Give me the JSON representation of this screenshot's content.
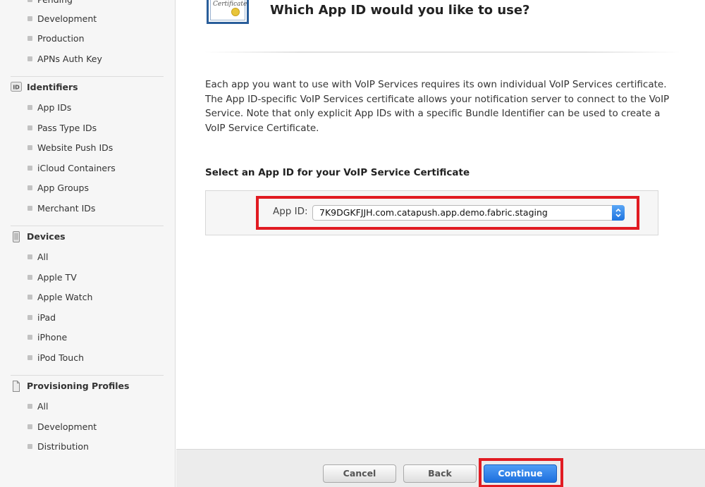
{
  "sidebar": {
    "certificates_items": [
      {
        "label": "Pending"
      },
      {
        "label": "Development"
      },
      {
        "label": "Production"
      },
      {
        "label": "APNs Auth Key"
      }
    ],
    "identifiers": {
      "title": "Identifiers",
      "icon": "id-badge-icon",
      "badge_text": "ID",
      "items": [
        {
          "label": "App IDs"
        },
        {
          "label": "Pass Type IDs"
        },
        {
          "label": "Website Push IDs"
        },
        {
          "label": "iCloud Containers"
        },
        {
          "label": "App Groups"
        },
        {
          "label": "Merchant IDs"
        }
      ]
    },
    "devices": {
      "title": "Devices",
      "icon": "iphone-icon",
      "items": [
        {
          "label": "All"
        },
        {
          "label": "Apple TV"
        },
        {
          "label": "Apple Watch"
        },
        {
          "label": "iPad"
        },
        {
          "label": "iPhone"
        },
        {
          "label": "iPod Touch"
        }
      ]
    },
    "provisioning": {
      "title": "Provisioning Profiles",
      "icon": "document-icon",
      "items": [
        {
          "label": "All"
        },
        {
          "label": "Development"
        },
        {
          "label": "Distribution"
        }
      ]
    }
  },
  "main": {
    "certificate_icon": {
      "name": "certificate-icon",
      "text": "Certificate"
    },
    "title": "Which App ID would you like to use?",
    "description": "Each app you want to use with VoIP Services requires its own individual VoIP Services certificate. The App ID-specific VoIP Services certificate allows your notification server to connect to the VoIP Service. Note that only explicit App IDs with a specific Bundle Identifier can be used to create a VoIP Service Certificate.",
    "select_heading": "Select an App ID for your VoIP Service Certificate",
    "app_id_label": "App ID:",
    "app_id_value": "7K9DGKFJJH.com.catapush.app.demo.fabric.staging"
  },
  "footer": {
    "cancel_label": "Cancel",
    "back_label": "Back",
    "continue_label": "Continue"
  },
  "colors": {
    "highlight": "#e11b22",
    "primary_button": "#1d6fde",
    "sidebar_bg": "#f6f6f6"
  }
}
